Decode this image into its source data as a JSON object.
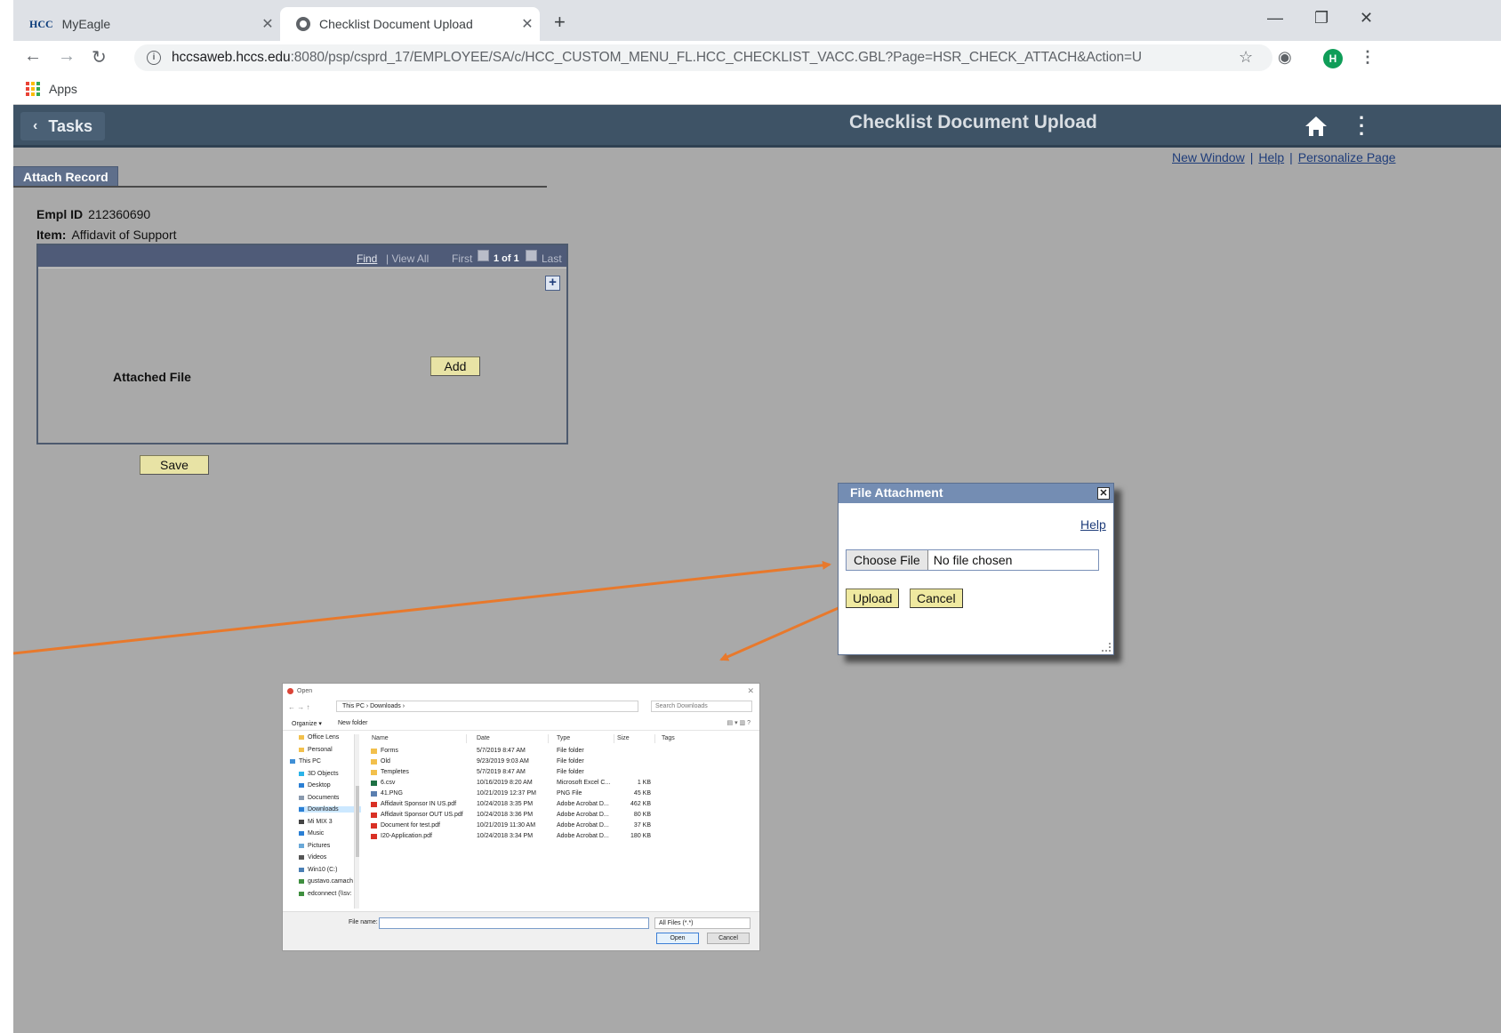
{
  "browser": {
    "tabs": [
      {
        "title": "MyEagle",
        "favicon": "HCC",
        "active": false
      },
      {
        "title": "Checklist Document Upload",
        "active": true
      }
    ],
    "url_host": "hccsaweb.hccs.edu",
    "url_rest": ":8080/psp/csprd_17/EMPLOYEE/SA/c/HCC_CUSTOM_MENU_FL.HCC_CHECKLIST_VACC.GBL?Page=HSR_CHECK_ATTACH&Action=U",
    "profile_initial": "H",
    "bookmarks": {
      "apps_label": "Apps"
    }
  },
  "page": {
    "tasks_label": "Tasks",
    "title": "Checklist Document Upload",
    "links": {
      "new_window": "New Window",
      "sep1": "|",
      "help": "Help",
      "sep2": "|",
      "personalize": "Personalize Page"
    },
    "tab_label": "Attach Record",
    "empl_id_label": "Empl ID",
    "empl_id_value": "212360690",
    "item_label": "Item:",
    "item_value": "Affidavit of Support",
    "grid": {
      "find": "Find",
      "view_all": "| View All",
      "first": "First",
      "counter": "1 of 1",
      "last": "Last",
      "plus": "+",
      "attached_file_label": "Attached File",
      "add_button": "Add"
    },
    "save_button": "Save"
  },
  "file_attachment": {
    "title": "File Attachment",
    "close": "✕",
    "help": "Help",
    "choose_file": "Choose File",
    "no_file": "No file chosen",
    "upload": "Upload",
    "cancel": "Cancel"
  },
  "open_dialog": {
    "title": "Open",
    "close": "✕",
    "nav": "←  →  ↑",
    "path": "This PC  ›  Downloads  ›",
    "search_placeholder": "Search Downloads",
    "organize": "Organize ▾",
    "new_folder": "New folder",
    "views": "▤ ▾  ▥  ?",
    "sidebar": [
      "Office Lens",
      "Personal",
      "This PC",
      "3D Objects",
      "Desktop",
      "Documents",
      "Downloads",
      "Mi MIX 3",
      "Music",
      "Pictures",
      "Videos",
      "Win10 (C:)",
      "gustavo.camach",
      "edconnect (\\\\sv:"
    ],
    "columns": {
      "name": "Name",
      "date": "Date",
      "type": "Type",
      "size": "Size",
      "tags": "Tags"
    },
    "files": [
      {
        "name": "Forms",
        "date": "5/7/2019 8:47 AM",
        "type": "File folder",
        "size": "",
        "kind": "folder"
      },
      {
        "name": "Old",
        "date": "9/23/2019 9:03 AM",
        "type": "File folder",
        "size": "",
        "kind": "folder"
      },
      {
        "name": "Templetes",
        "date": "5/7/2019 8:47 AM",
        "type": "File folder",
        "size": "",
        "kind": "folder"
      },
      {
        "name": "6.csv",
        "date": "10/16/2019 8:20 AM",
        "type": "Microsoft Excel C...",
        "size": "1 KB",
        "kind": "excel"
      },
      {
        "name": "41.PNG",
        "date": "10/21/2019 12:37 PM",
        "type": "PNG File",
        "size": "45 KB",
        "kind": "image"
      },
      {
        "name": "Affidavit Sponsor IN US.pdf",
        "date": "10/24/2018 3:35 PM",
        "type": "Adobe Acrobat D...",
        "size": "462 KB",
        "kind": "pdf"
      },
      {
        "name": "Affidavit Sponsor OUT US.pdf",
        "date": "10/24/2018 3:36 PM",
        "type": "Adobe Acrobat D...",
        "size": "80 KB",
        "kind": "pdf"
      },
      {
        "name": "Document for test.pdf",
        "date": "10/21/2019 11:30 AM",
        "type": "Adobe Acrobat D...",
        "size": "37 KB",
        "kind": "pdf"
      },
      {
        "name": "I20-Application.pdf",
        "date": "10/24/2018 3:34 PM",
        "type": "Adobe Acrobat D...",
        "size": "180 KB",
        "kind": "pdf"
      }
    ],
    "file_name_label": "File name:",
    "filter": "All Files (*.*)",
    "open_button": "Open",
    "cancel_button": "Cancel"
  },
  "colors": {
    "header": "#3e5366",
    "page_bg": "#a9a9a9",
    "arrow": "#e8792c",
    "ps_button": "#e8e3a5"
  }
}
